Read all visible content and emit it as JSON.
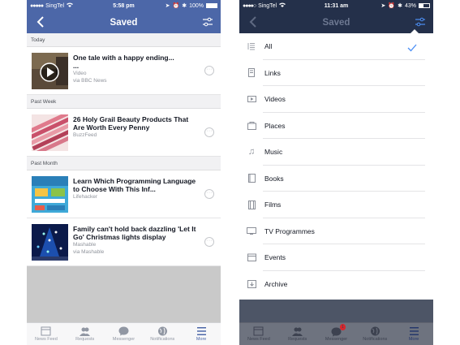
{
  "left": {
    "status": {
      "carrier": "SingTel",
      "time": "5:58 pm",
      "battery": "100%",
      "battery_level": 1.0
    },
    "nav": {
      "title": "Saved"
    },
    "sections": [
      {
        "header": "Today",
        "items": [
          {
            "title": "One tale with a happy ending...",
            "title2": "...",
            "line1": "Video",
            "line2": "via BBC News",
            "thumb": "video"
          }
        ]
      },
      {
        "header": "Past Week",
        "items": [
          {
            "title": "26 Holy Grail Beauty Products That Are Worth Every Penny",
            "line1": "BuzzFeed",
            "thumb": "beauty"
          }
        ]
      },
      {
        "header": "Past Month",
        "items": [
          {
            "title": "Learn Which Programming Language to Choose With This Inf...",
            "line1": "Lifehacker",
            "thumb": "infographic"
          },
          {
            "title": "Family can't hold back dazzling 'Let It Go' Christmas lights display",
            "line1": "Mashable",
            "line2": "via Mashable",
            "thumb": "lights"
          }
        ]
      }
    ],
    "tabs": [
      {
        "label": "News Feed",
        "icon": "news-feed-icon"
      },
      {
        "label": "Requests",
        "icon": "requests-icon"
      },
      {
        "label": "Messenger",
        "icon": "messenger-icon"
      },
      {
        "label": "Notifications",
        "icon": "globe-icon"
      },
      {
        "label": "More",
        "icon": "menu-icon",
        "active": true
      }
    ]
  },
  "right": {
    "status": {
      "carrier": "SingTel",
      "time": "11:31 am",
      "battery": "43%",
      "battery_level": 0.43
    },
    "nav": {
      "title": "Saved"
    },
    "menu": [
      {
        "label": "All",
        "icon": "list-icon",
        "selected": true
      },
      {
        "label": "Links",
        "icon": "link-icon"
      },
      {
        "label": "Videos",
        "icon": "video-icon"
      },
      {
        "label": "Places",
        "icon": "place-icon"
      },
      {
        "label": "Music",
        "icon": "music-icon"
      },
      {
        "label": "Books",
        "icon": "book-icon"
      },
      {
        "label": "Films",
        "icon": "film-icon"
      },
      {
        "label": "TV Programmes",
        "icon": "tv-icon"
      },
      {
        "label": "Events",
        "icon": "event-icon"
      },
      {
        "label": "Archive",
        "icon": "archive-icon"
      }
    ],
    "tabs": [
      {
        "label": "News Feed",
        "icon": "news-feed-icon"
      },
      {
        "label": "Requests",
        "icon": "requests-icon"
      },
      {
        "label": "Messenger",
        "icon": "messenger-icon",
        "badge": "1"
      },
      {
        "label": "Notifications",
        "icon": "globe-icon"
      },
      {
        "label": "More",
        "icon": "menu-icon",
        "active": true
      }
    ]
  },
  "colors": {
    "fb_blue": "#4c67a8",
    "dark_nav": "#24304a",
    "check": "#4c8ff5",
    "badge": "#d7272d"
  }
}
